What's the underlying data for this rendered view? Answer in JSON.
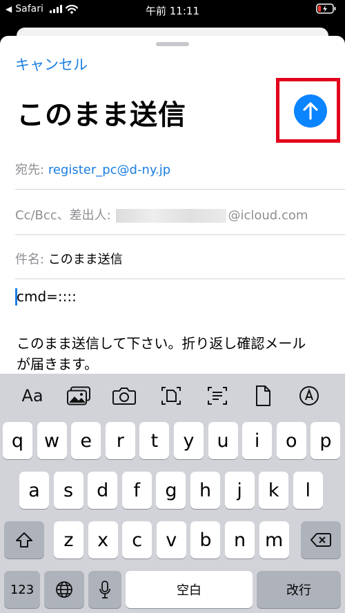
{
  "status_bar": {
    "back_app": "Safari",
    "time": "午前 11:11"
  },
  "sheet": {
    "cancel_label": "キャンセル",
    "title": "このまま送信",
    "to_label": "宛先:",
    "to_value": "register_pc@d-ny.jp",
    "cc_label": "Cc/Bcc、差出人:",
    "cc_domain": "@icloud.com",
    "subject_label": "件名:",
    "subject_value": "このまま送信",
    "body_line1": "cmd=::::",
    "body_line2": "このまま送信して下さい。折り返し確認メール",
    "body_line3": "が届きます。"
  },
  "toolbar": {
    "format_label": "Aa",
    "icons": [
      "photo-library-icon",
      "camera-icon",
      "scan-document-icon",
      "scan-text-icon",
      "attach-file-icon",
      "markup-icon"
    ]
  },
  "keyboard": {
    "row1": [
      "q",
      "w",
      "e",
      "r",
      "t",
      "y",
      "u",
      "i",
      "o",
      "p"
    ],
    "row2": [
      "a",
      "s",
      "d",
      "f",
      "g",
      "h",
      "j",
      "k",
      "l"
    ],
    "row3": [
      "z",
      "x",
      "c",
      "v",
      "b",
      "n",
      "m"
    ],
    "numbers_label": "123",
    "space_label": "空白",
    "return_label": "改行"
  },
  "colors": {
    "accent": "#1a7ee2",
    "send_button": "#0a84ff",
    "highlight": "#e3001b"
  }
}
